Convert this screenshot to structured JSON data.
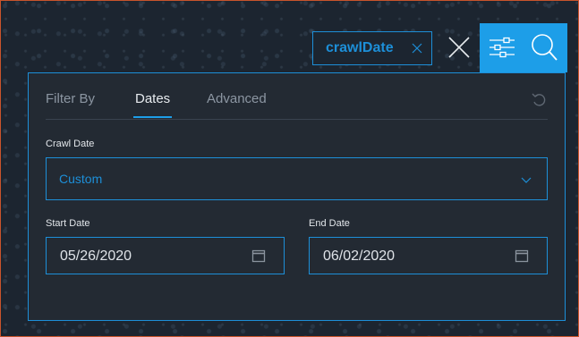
{
  "filter_tag": {
    "label": "crawlDate",
    "remove_icon": "close-icon"
  },
  "toolbar": {
    "close_icon": "close-icon",
    "filter_icon": "sliders-icon",
    "search_icon": "search-icon",
    "accent_color": "#1d9ee8"
  },
  "panel": {
    "tabs": [
      {
        "label": "Filter By",
        "active": false
      },
      {
        "label": "Dates",
        "active": true
      },
      {
        "label": "Advanced",
        "active": false
      }
    ],
    "reset_icon": "undo-icon",
    "crawl_date": {
      "label": "Crawl Date",
      "value": "Custom",
      "dropdown_icon": "chevron-down-icon"
    },
    "start_date": {
      "label": "Start Date",
      "value": "05/26/2020",
      "icon": "calendar-icon"
    },
    "end_date": {
      "label": "End Date",
      "value": "06/02/2020",
      "icon": "calendar-icon"
    }
  }
}
